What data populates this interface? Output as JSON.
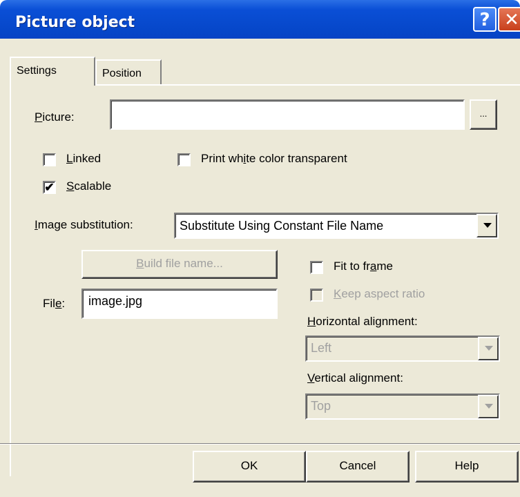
{
  "window": {
    "title": "Picture object",
    "help_glyph": "?",
    "close_glyph": "✕"
  },
  "tabs": [
    {
      "label": "Settings",
      "active": true
    },
    {
      "label": "Position",
      "active": false
    }
  ],
  "picture": {
    "label_accel": "P",
    "label_rest": "icture:",
    "value": "",
    "browse_label": "..."
  },
  "linked": {
    "accel": "L",
    "rest": "inked",
    "checked": false
  },
  "print_white": {
    "before": "Print wh",
    "accel": "i",
    "after": "te color transparent",
    "checked": false
  },
  "scalable": {
    "accel": "S",
    "rest": "calable",
    "checked": true
  },
  "image_substitution": {
    "accel": "I",
    "rest": "mage substitution:",
    "selected": "Substitute Using Constant File Name"
  },
  "build_file_name": {
    "accel": "B",
    "rest": "uild file name...",
    "enabled": false
  },
  "file": {
    "label_before": "Fil",
    "label_accel": "e",
    "label_after": ":",
    "value": "image.jpg"
  },
  "fit_to_frame": {
    "before": "Fit to fr",
    "accel": "a",
    "after": "me",
    "checked": false
  },
  "keep_aspect": {
    "accel": "K",
    "rest": "eep aspect ratio",
    "checked": false,
    "enabled": false
  },
  "horizontal_alignment": {
    "accel": "H",
    "rest": "orizontal alignment:",
    "selected": "Left",
    "enabled": false
  },
  "vertical_alignment": {
    "accel": "V",
    "rest": "ertical alignment:",
    "selected": "Top",
    "enabled": false
  },
  "buttons": {
    "ok": "OK",
    "cancel": "Cancel",
    "help": "Help"
  },
  "colors": {
    "title_bar": "#0646c8",
    "face": "#ece9d8",
    "close": "#c8401c",
    "disabled_text": "#a0a0a0"
  }
}
